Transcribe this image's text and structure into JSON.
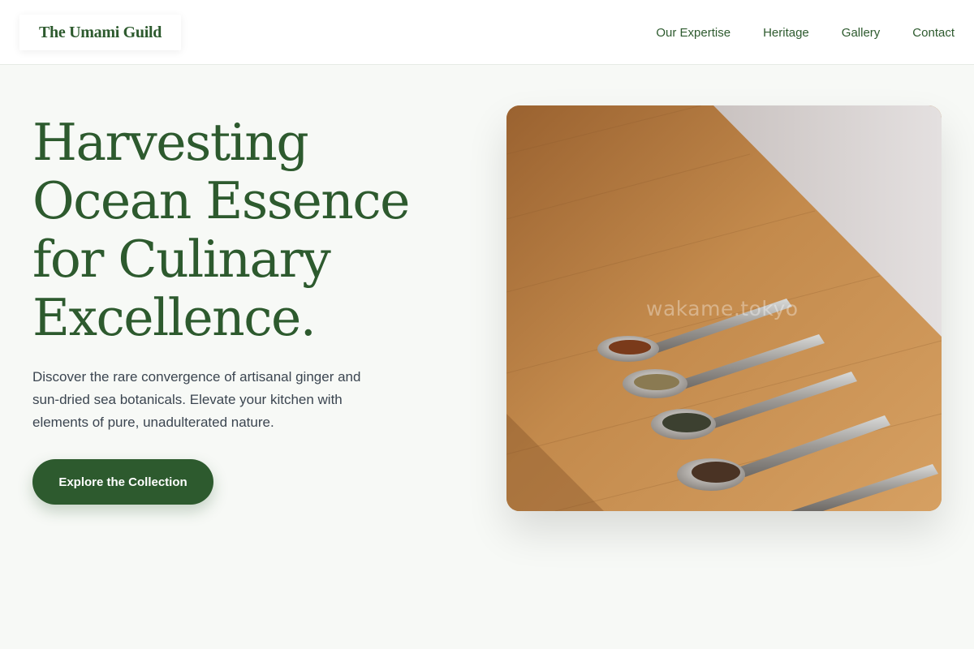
{
  "brand": {
    "name": "The Umami Guild"
  },
  "nav": {
    "items": [
      {
        "label": "Our Expertise"
      },
      {
        "label": "Heritage"
      },
      {
        "label": "Gallery"
      },
      {
        "label": "Contact"
      }
    ]
  },
  "hero": {
    "title_lines": [
      "Harvesting",
      "Ocean Essence",
      "for Culinary",
      "Excellence."
    ],
    "description": "Discover the rare convergence of artisanal ginger and sun-dried sea botanicals. Elevate your kitchen with elements of pure, unadulterated nature.",
    "cta_label": "Explore the Collection"
  },
  "image": {
    "subject": "spice tasting spoons on a wooden board",
    "watermark": "wakame.tokyo"
  },
  "colors": {
    "primary": "#2d5a2e",
    "background": "#f7f9f6",
    "body_text": "#3b4550"
  }
}
